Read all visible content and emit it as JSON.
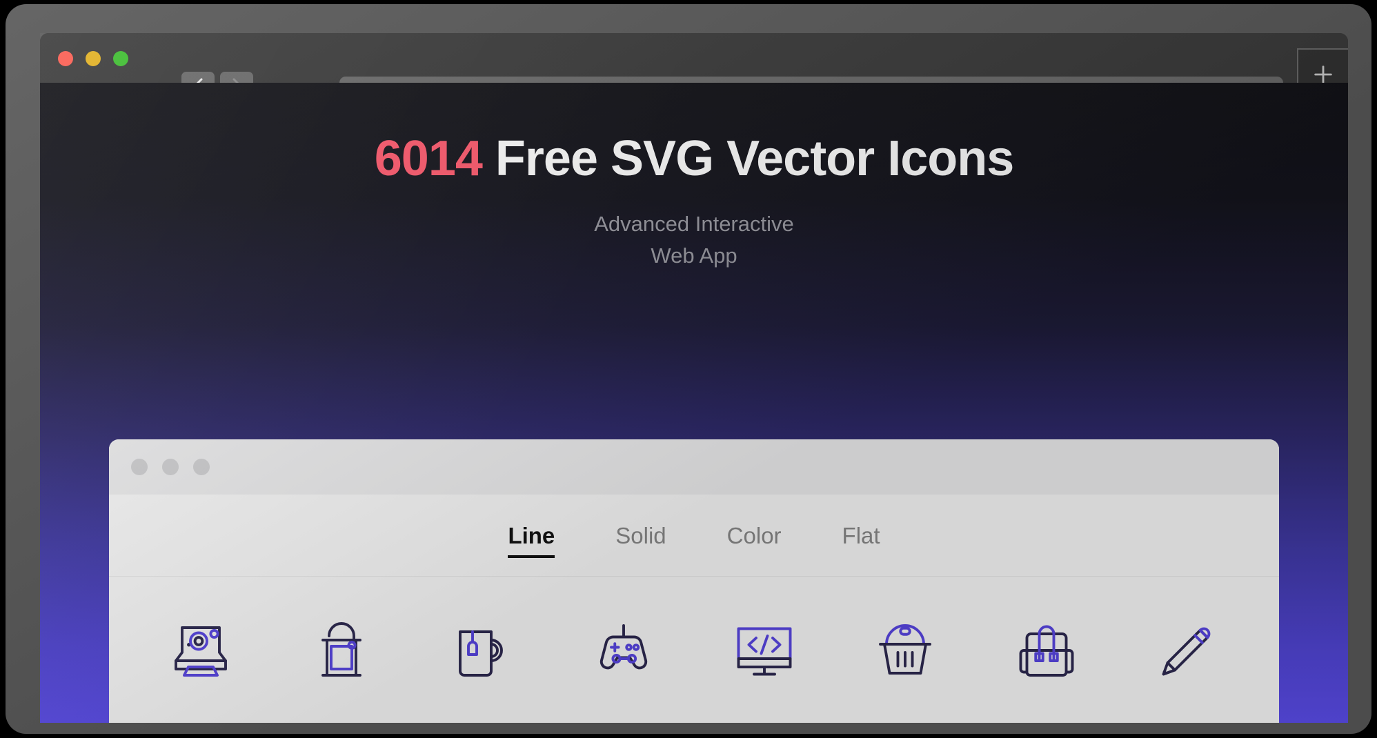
{
  "browser": {
    "traffic_lights": [
      {
        "name": "close",
        "color": "#ff5f52"
      },
      {
        "name": "minimize",
        "color": "#e6b422"
      },
      {
        "name": "maximize",
        "color": "#3ec030"
      }
    ],
    "back_icon": "chevron-left-icon",
    "forward_icon": "chevron-right-icon",
    "address_value": "",
    "address_placeholder": "",
    "reload_icon": "reload-icon",
    "newtab_icon": "plus-icon"
  },
  "hero": {
    "count": "6014",
    "title_rest": " Free SVG Vector Icons",
    "subtitle_line1": "Advanced Interactive",
    "subtitle_line2": "Web App",
    "count_color": "#ff5a6e",
    "title_color": "#ffffff",
    "subtitle_color": "#9b9ba3"
  },
  "card": {
    "window_dots": 3,
    "tabs": [
      {
        "label": "Line",
        "active": true
      },
      {
        "label": "Solid",
        "active": false
      },
      {
        "label": "Color",
        "active": false
      },
      {
        "label": "Flat",
        "active": false
      }
    ],
    "icons": [
      {
        "name": "instant-camera-icon",
        "label": "Instant Camera"
      },
      {
        "name": "paint-bucket-icon",
        "label": "Paint Bucket"
      },
      {
        "name": "tea-mug-icon",
        "label": "Tea Mug"
      },
      {
        "name": "gamepad-icon",
        "label": "Gamepad"
      },
      {
        "name": "code-monitor-icon",
        "label": "Code Monitor"
      },
      {
        "name": "shopping-basket-icon",
        "label": "Shopping Basket"
      },
      {
        "name": "backpack-icon",
        "label": "Backpack"
      },
      {
        "name": "pencil-icon",
        "label": "Pencil"
      }
    ],
    "icon_dark_color": "#2e2a52",
    "icon_accent_color": "#5a47e8"
  },
  "theme": {
    "gradient_top": "#121217",
    "gradient_bottom": "#5d4ef0",
    "bezel": "#5a5a5a",
    "toolbar": "#3b3b3b"
  }
}
